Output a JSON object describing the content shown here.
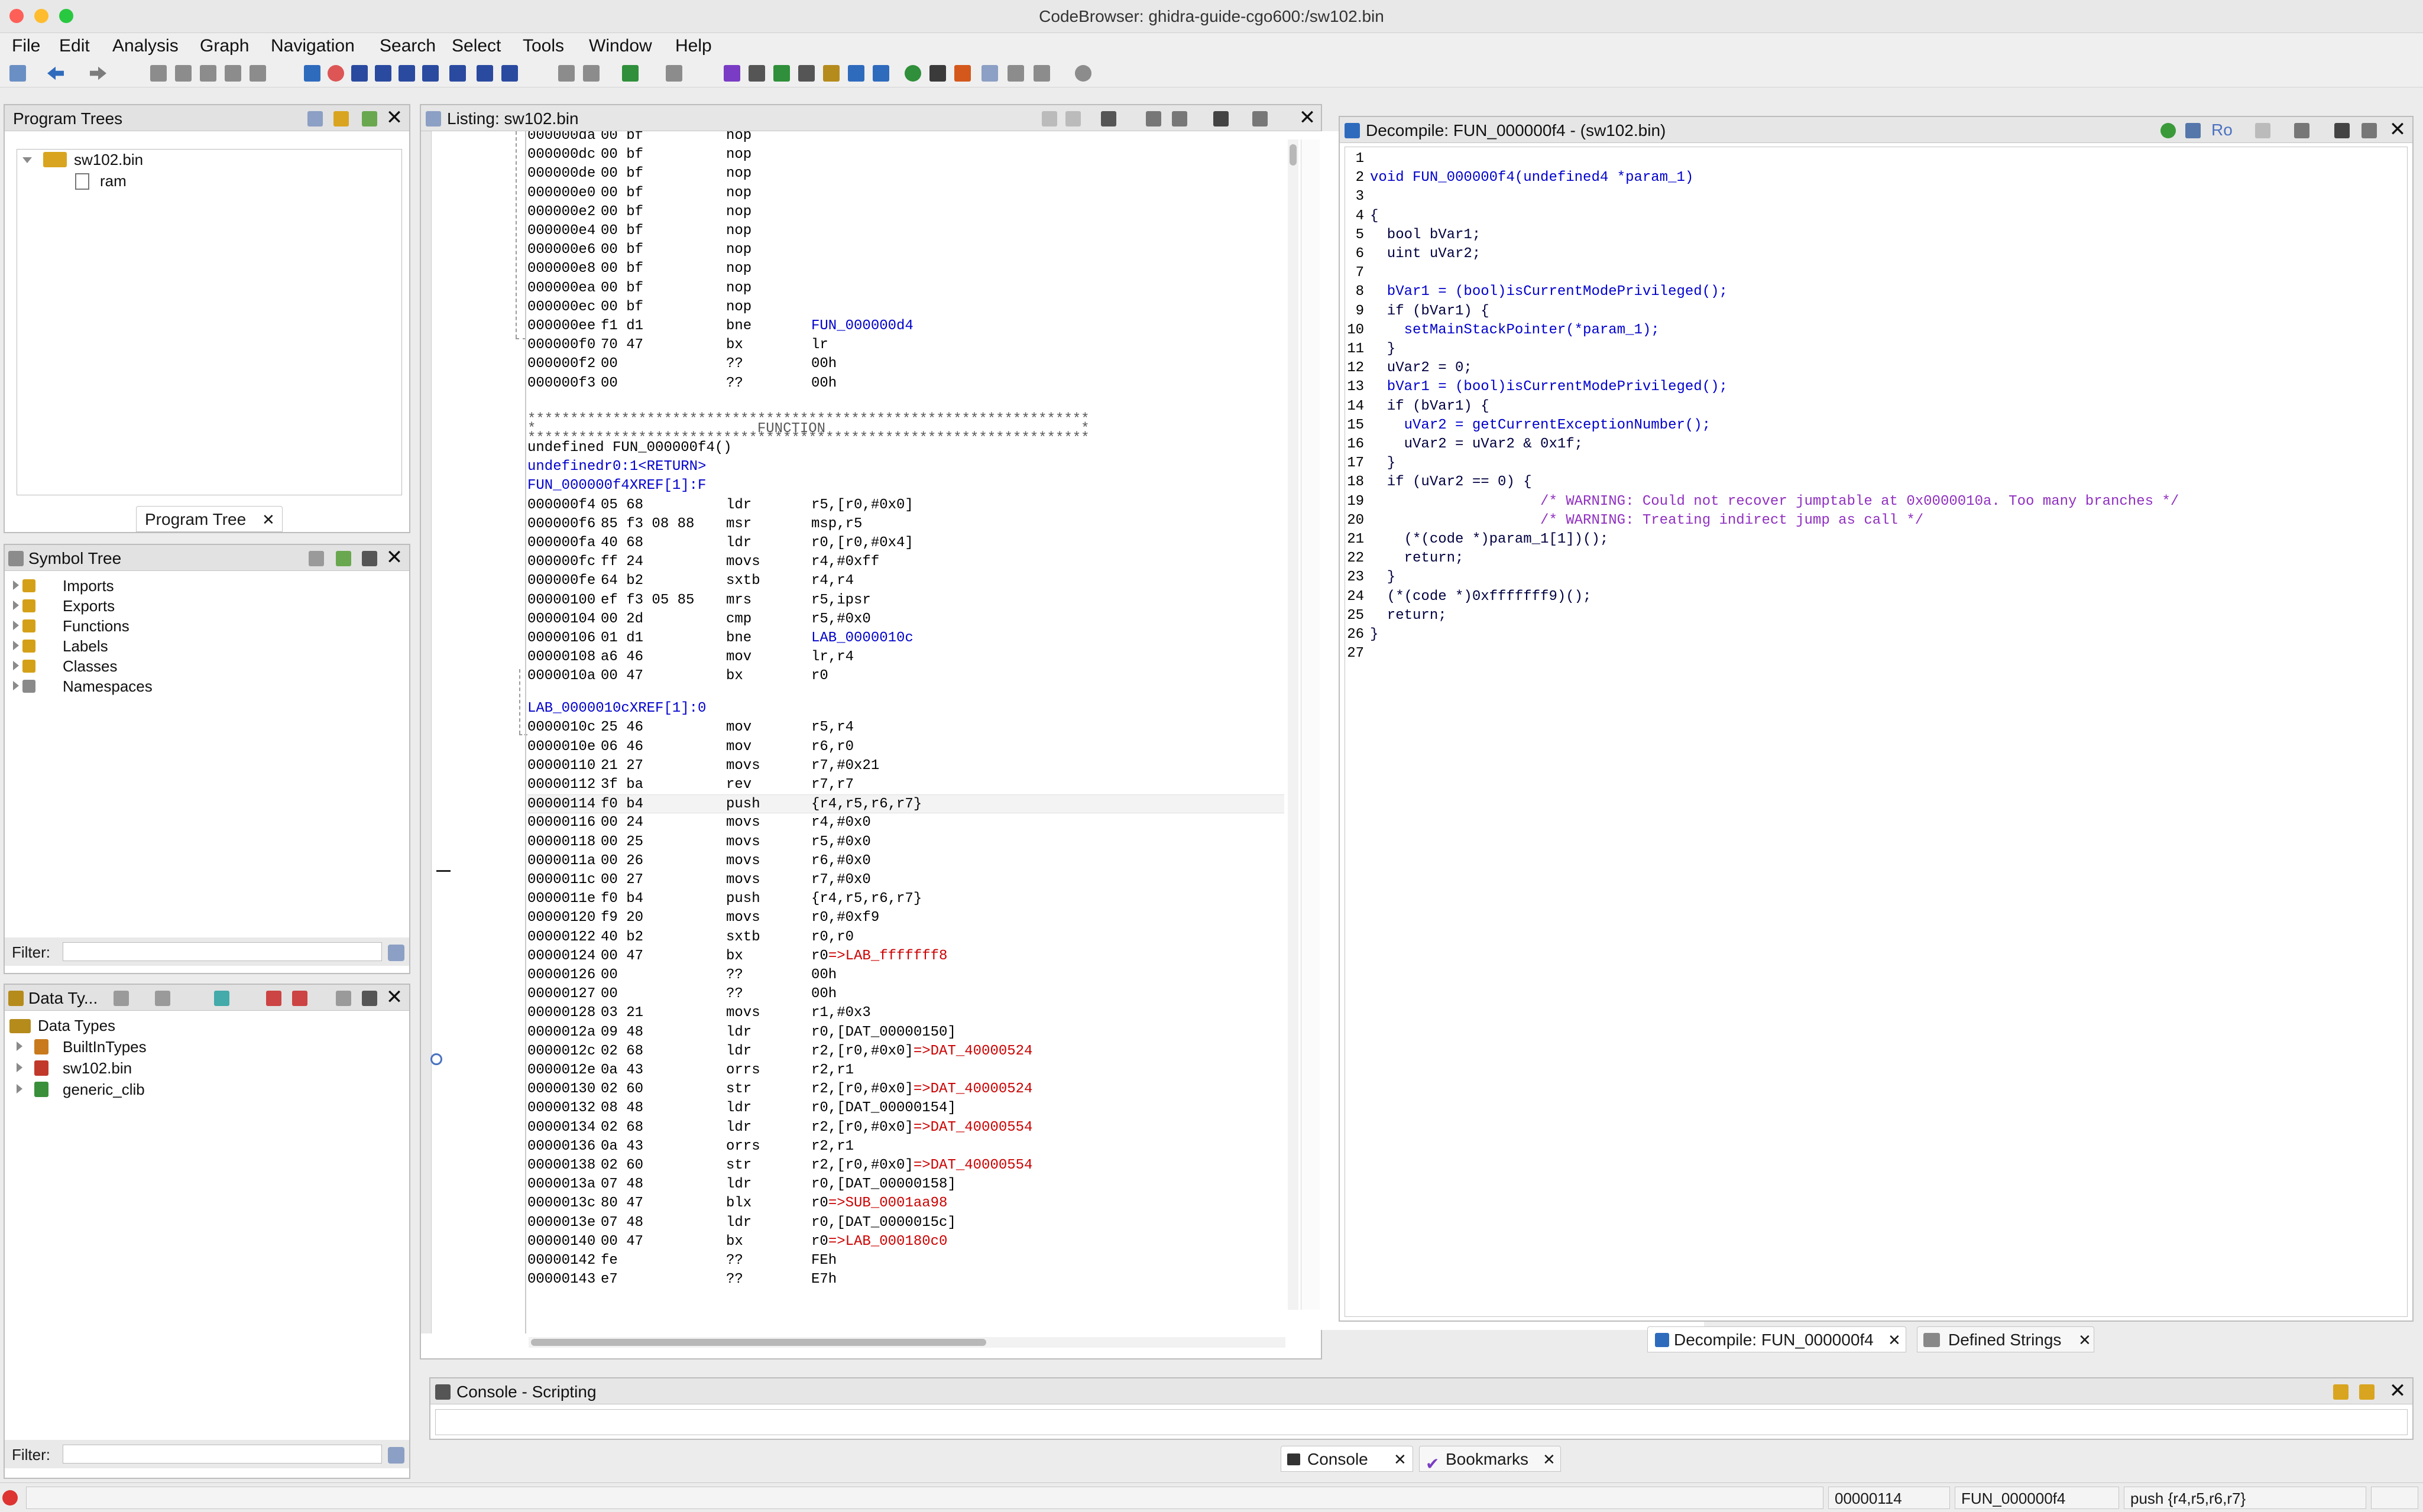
{
  "window": {
    "title": "CodeBrowser: ghidra-guide-cgo600:/sw102.bin"
  },
  "menu": [
    "File",
    "Edit",
    "Analysis",
    "Graph",
    "Navigation",
    "Search",
    "Select",
    "Tools",
    "Window",
    "Help"
  ],
  "program_trees": {
    "title": "Program Trees",
    "root": "sw102.bin",
    "child": "ram",
    "tab_label": "Program Tree"
  },
  "symbol_tree": {
    "title": "Symbol Tree",
    "items": [
      "Imports",
      "Exports",
      "Functions",
      "Labels",
      "Classes",
      "Namespaces"
    ],
    "filter_label": "Filter:"
  },
  "data_types": {
    "title": "Data Ty...",
    "root": "Data Types",
    "items": [
      "BuiltInTypes",
      "sw102.bin",
      "generic_clib"
    ],
    "filter_label": "Filter:"
  },
  "listing": {
    "title": "Listing:  sw102.bin",
    "header_top": "******************************************************************",
    "header_mid": "*                          FUNCTION                              *",
    "header_bot": "******************************************************************",
    "signature": "undefined FUN_000000f4()",
    "return_type": "undefined",
    "return_reg": "r0:1",
    "return_label": "<RETURN>",
    "func_label": "FUN_000000f4",
    "lab_label": "LAB_0000010c",
    "xref_1": "XREF[1]:",
    "xref_1_tail": "F",
    "xref_2": "XREF[1]:",
    "xref_2_tail": "0",
    "rows_before": [
      {
        "addr": "000000da",
        "bytes": "00 bf",
        "mn": "nop",
        "op": ""
      },
      {
        "addr": "000000dc",
        "bytes": "00 bf",
        "mn": "nop",
        "op": ""
      },
      {
        "addr": "000000de",
        "bytes": "00 bf",
        "mn": "nop",
        "op": ""
      },
      {
        "addr": "000000e0",
        "bytes": "00 bf",
        "mn": "nop",
        "op": ""
      },
      {
        "addr": "000000e2",
        "bytes": "00 bf",
        "mn": "nop",
        "op": ""
      },
      {
        "addr": "000000e4",
        "bytes": "00 bf",
        "mn": "nop",
        "op": ""
      },
      {
        "addr": "000000e6",
        "bytes": "00 bf",
        "mn": "nop",
        "op": ""
      },
      {
        "addr": "000000e8",
        "bytes": "00 bf",
        "mn": "nop",
        "op": ""
      },
      {
        "addr": "000000ea",
        "bytes": "00 bf",
        "mn": "nop",
        "op": ""
      },
      {
        "addr": "000000ec",
        "bytes": "00 bf",
        "mn": "nop",
        "op": ""
      },
      {
        "addr": "000000ee",
        "bytes": "f1 d1",
        "mn": "bne",
        "op": "FUN_000000d4"
      },
      {
        "addr": "000000f0",
        "bytes": "70 47",
        "mn": "bx",
        "op": "lr"
      },
      {
        "addr": "000000f2",
        "bytes": "00",
        "mn": "??",
        "op": "00h"
      },
      {
        "addr": "000000f3",
        "bytes": "00",
        "mn": "??",
        "op": "00h"
      }
    ],
    "rows_func": [
      {
        "addr": "000000f4",
        "bytes": "05 68",
        "mn": "ldr",
        "op": "r5,[r0,#0x0]"
      },
      {
        "addr": "000000f6",
        "bytes": "85 f3 08 88",
        "mn": "msr",
        "op": "msp,r5"
      },
      {
        "addr": "000000fa",
        "bytes": "40 68",
        "mn": "ldr",
        "op": "r0,[r0,#0x4]"
      },
      {
        "addr": "000000fc",
        "bytes": "ff 24",
        "mn": "movs",
        "op": "r4,#0xff"
      },
      {
        "addr": "000000fe",
        "bytes": "64 b2",
        "mn": "sxtb",
        "op": "r4,r4"
      },
      {
        "addr": "00000100",
        "bytes": "ef f3 05 85",
        "mn": "mrs",
        "op": "r5,ipsr"
      },
      {
        "addr": "00000104",
        "bytes": "00 2d",
        "mn": "cmp",
        "op": "r5,#0x0"
      },
      {
        "addr": "00000106",
        "bytes": "01 d1",
        "mn": "bne",
        "op": "LAB_0000010c"
      },
      {
        "addr": "00000108",
        "bytes": "a6 46",
        "mn": "mov",
        "op": "lr,r4"
      },
      {
        "addr": "0000010a",
        "bytes": "00 47",
        "mn": "bx",
        "op": "r0"
      }
    ],
    "rows_lab": [
      {
        "addr": "0000010c",
        "bytes": "25 46",
        "mn": "mov",
        "op": "r5,r4",
        "ref": ""
      },
      {
        "addr": "0000010e",
        "bytes": "06 46",
        "mn": "mov",
        "op": "r6,r0",
        "ref": ""
      },
      {
        "addr": "00000110",
        "bytes": "21 27",
        "mn": "movs",
        "op": "r7,#0x21",
        "ref": ""
      },
      {
        "addr": "00000112",
        "bytes": "3f ba",
        "mn": "rev",
        "op": "r7,r7",
        "ref": ""
      },
      {
        "addr": "00000114",
        "bytes": "f0 b4",
        "mn": "push",
        "op": "{r4,r5,r6,r7}",
        "ref": ""
      },
      {
        "addr": "00000116",
        "bytes": "00 24",
        "mn": "movs",
        "op": "r4,#0x0",
        "ref": ""
      },
      {
        "addr": "00000118",
        "bytes": "00 25",
        "mn": "movs",
        "op": "r5,#0x0",
        "ref": ""
      },
      {
        "addr": "0000011a",
        "bytes": "00 26",
        "mn": "movs",
        "op": "r6,#0x0",
        "ref": ""
      },
      {
        "addr": "0000011c",
        "bytes": "00 27",
        "mn": "movs",
        "op": "r7,#0x0",
        "ref": ""
      },
      {
        "addr": "0000011e",
        "bytes": "f0 b4",
        "mn": "push",
        "op": "{r4,r5,r6,r7}",
        "ref": ""
      },
      {
        "addr": "00000120",
        "bytes": "f9 20",
        "mn": "movs",
        "op": "r0,#0xf9",
        "ref": ""
      },
      {
        "addr": "00000122",
        "bytes": "40 b2",
        "mn": "sxtb",
        "op": "r0,r0",
        "ref": ""
      },
      {
        "addr": "00000124",
        "bytes": "00 47",
        "mn": "bx",
        "op": "r0",
        "ref": "=>LAB_fffffff8"
      },
      {
        "addr": "00000126",
        "bytes": "00",
        "mn": "??",
        "op": "00h",
        "ref": ""
      },
      {
        "addr": "00000127",
        "bytes": "00",
        "mn": "??",
        "op": "00h",
        "ref": ""
      },
      {
        "addr": "00000128",
        "bytes": "03 21",
        "mn": "movs",
        "op": "r1,#0x3",
        "ref": ""
      },
      {
        "addr": "0000012a",
        "bytes": "09 48",
        "mn": "ldr",
        "op": "r0,[DAT_00000150]",
        "ref": ""
      },
      {
        "addr": "0000012c",
        "bytes": "02 68",
        "mn": "ldr",
        "op": "r2,[r0,#0x0]",
        "ref": "=>DAT_40000524"
      },
      {
        "addr": "0000012e",
        "bytes": "0a 43",
        "mn": "orrs",
        "op": "r2,r1",
        "ref": ""
      },
      {
        "addr": "00000130",
        "bytes": "02 60",
        "mn": "str",
        "op": "r2,[r0,#0x0]",
        "ref": "=>DAT_40000524"
      },
      {
        "addr": "00000132",
        "bytes": "08 48",
        "mn": "ldr",
        "op": "r0,[DAT_00000154]",
        "ref": ""
      },
      {
        "addr": "00000134",
        "bytes": "02 68",
        "mn": "ldr",
        "op": "r2,[r0,#0x0]",
        "ref": "=>DAT_40000554"
      },
      {
        "addr": "00000136",
        "bytes": "0a 43",
        "mn": "orrs",
        "op": "r2,r1",
        "ref": ""
      },
      {
        "addr": "00000138",
        "bytes": "02 60",
        "mn": "str",
        "op": "r2,[r0,#0x0]",
        "ref": "=>DAT_40000554"
      },
      {
        "addr": "0000013a",
        "bytes": "07 48",
        "mn": "ldr",
        "op": "r0,[DAT_00000158]",
        "ref": ""
      },
      {
        "addr": "0000013c",
        "bytes": "80 47",
        "mn": "blx",
        "op": "r0",
        "ref": "=>SUB_0001aa98"
      },
      {
        "addr": "0000013e",
        "bytes": "07 48",
        "mn": "ldr",
        "op": "r0,[DAT_0000015c]",
        "ref": ""
      },
      {
        "addr": "00000140",
        "bytes": "00 47",
        "mn": "bx",
        "op": "r0",
        "ref": "=>LAB_000180c0"
      },
      {
        "addr": "00000142",
        "bytes": "fe",
        "mn": "??",
        "op": "FEh",
        "ref": ""
      },
      {
        "addr": "00000143",
        "bytes": "e7",
        "mn": "??",
        "op": "E7h",
        "ref": ""
      }
    ]
  },
  "decompile": {
    "title": "Decompile: FUN_000000f4 -  (sw102.bin)",
    "ro_label": "Ro",
    "lines": [
      "",
      "void FUN_000000f4(undefined4 *param_1)",
      "",
      "{",
      "  bool bVar1;",
      "  uint uVar2;",
      "  ",
      "  bVar1 = (bool)isCurrentModePrivileged();",
      "  if (bVar1) {",
      "    setMainStackPointer(*param_1);",
      "  }",
      "  uVar2 = 0;",
      "  bVar1 = (bool)isCurrentModePrivileged();",
      "  if (bVar1) {",
      "    uVar2 = getCurrentExceptionNumber();",
      "    uVar2 = uVar2 & 0x1f;",
      "  }",
      "  if (uVar2 == 0) {",
      "                    /* WARNING: Could not recover jumptable at 0x0000010a. Too many branches */",
      "                    /* WARNING: Treating indirect jump as call */",
      "    (*(code *)param_1[1])();",
      "    return;",
      "  }",
      "  (*(code *)0xfffffff9)();",
      "  return;",
      "}",
      ""
    ],
    "tabs": [
      "Decompile: FUN_000000f4",
      "Defined Strings"
    ]
  },
  "console": {
    "title": "Console - Scripting",
    "tabs": [
      "Console",
      "Bookmarks"
    ]
  },
  "status": {
    "address": "00000114",
    "function": "FUN_000000f4",
    "instruction": "push {r4,r5,r6,r7}"
  },
  "colors": {
    "accent_blue": "#0000ff",
    "ref_red": "#cc0000",
    "comment_purple": "#9030c0"
  }
}
